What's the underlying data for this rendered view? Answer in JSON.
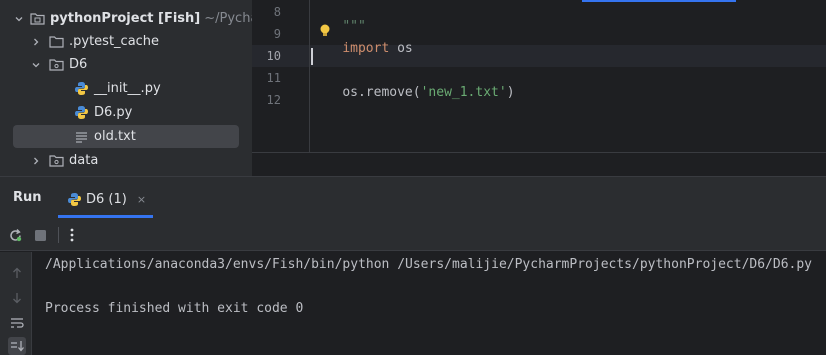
{
  "project_tree": {
    "root": {
      "name": "pythonProject [Fish]",
      "path": "~/Pycharm"
    },
    "items": [
      {
        "label": ".pytest_cache"
      },
      {
        "label": "D6"
      },
      {
        "label": "__init__.py"
      },
      {
        "label": "D6.py"
      },
      {
        "label": "old.txt"
      },
      {
        "label": "data"
      }
    ]
  },
  "editor": {
    "line_numbers": [
      "8",
      "9",
      "10",
      "11",
      "12"
    ],
    "lines": {
      "l8": "\"\"\"",
      "l9_kw": "import",
      "l9_rest": " os",
      "l11_fn": "os.remove(",
      "l11_str": "'new_1.txt'",
      "l11_end": ")"
    }
  },
  "run_panel": {
    "title": "Run",
    "tab_label": "D6 (1)",
    "tab_close": "×",
    "console": {
      "command": "/Applications/anaconda3/envs/Fish/bin/python /Users/malijie/PycharmProjects/pythonProject/D6/D6.py",
      "result": "Process finished with exit code 0"
    }
  },
  "icons": {
    "folder": "folder-icon",
    "python": "python-file-icon",
    "text": "text-file-icon",
    "rerun": "rerun-icon",
    "stop": "stop-icon",
    "more": "more-vertical-icon"
  },
  "colors": {
    "accent": "#3574f0",
    "keyword": "#cf8e6d",
    "string": "#6aab73"
  }
}
